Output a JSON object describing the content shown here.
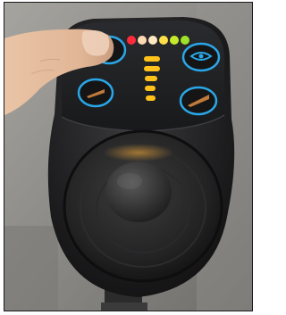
{
  "scene": {
    "subject": "power-wheelchair-joystick-controller",
    "battery_indicator": {
      "colors": [
        "#ff2a3a",
        "#ffd9b0",
        "#ffe9c4",
        "#ffe04a",
        "#c6ea2a",
        "#9ee22a"
      ],
      "lit_count": 6
    },
    "speed_indicator": {
      "segments": 5,
      "lit_count": 5,
      "color": "#ffc21a"
    },
    "buttons": [
      {
        "id": "power",
        "icon": "power-icon"
      },
      {
        "id": "horn",
        "icon": "horn-icon"
      },
      {
        "id": "speed-down",
        "icon": "speed-down-icon"
      },
      {
        "id": "speed-up",
        "icon": "speed-up-icon"
      }
    ],
    "button_ring_color": "#2aa7e8",
    "housing_color": "#1e1f21"
  }
}
